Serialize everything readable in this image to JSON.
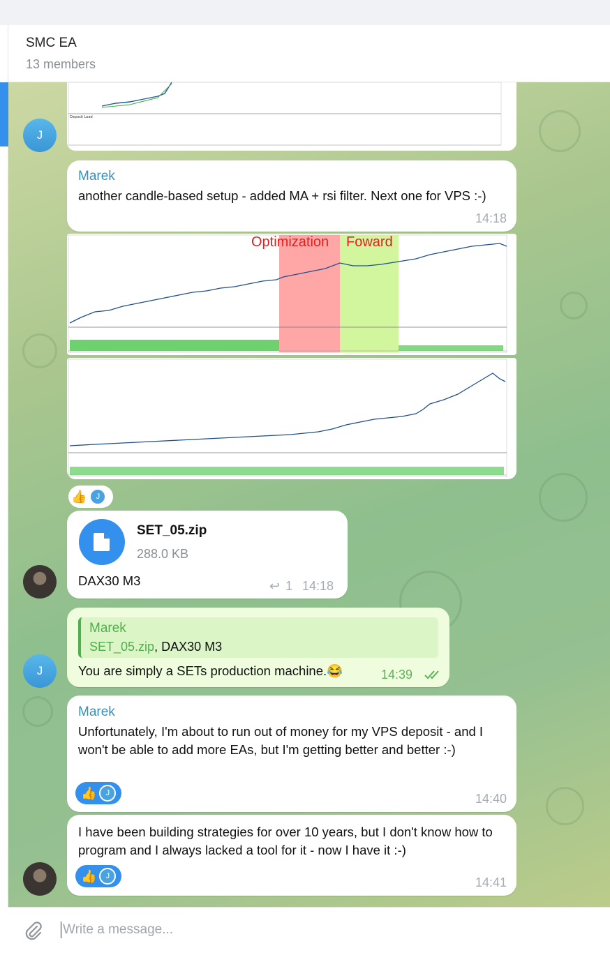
{
  "header": {
    "title": "SMC EA",
    "subtitle": "13 members"
  },
  "composer": {
    "placeholder": "Write a message..."
  },
  "messages": {
    "m1": {
      "sender": "Marek",
      "text": "another candle-based setup - added MA + rsi filter. Next one for VPS :-)",
      "time": "14:18"
    },
    "chart1": {
      "label_optimization": "Optimization",
      "label_forward": "Foward"
    },
    "file": {
      "name": "SET_05.zip",
      "size": "288.0 KB",
      "caption": "DAX30 M3",
      "replies": "1",
      "time": "14:18"
    },
    "reply": {
      "quote_sender": "Marek",
      "quote_file": "SET_05.zip",
      "quote_rest": ", DAX30 M3",
      "text": "You are simply a SETs production machine.",
      "emoji": "😂",
      "time": "14:39"
    },
    "m2": {
      "sender": "Marek",
      "text": "Unfortunately, I'm about to run out of money for my VPS deposit - and I won't be able to add more EAs, but I'm getting better and better :-)",
      "time": "14:40"
    },
    "m3": {
      "text": "I have been building strategies for over 10 years, but I don't know how to program and I always lacked a tool for it - now I have it :-)",
      "time": "14:41"
    }
  },
  "reactions": {
    "thumb": "👍",
    "initial": "J"
  },
  "avatars": {
    "j_initial": "J"
  },
  "icons": {
    "attach": "paperclip-icon",
    "file": "file-icon",
    "reply": "reply-icon",
    "read": "double-check-icon"
  },
  "colors": {
    "accent": "#3390ec",
    "sender": "#3a8fb7",
    "own_bubble": "#effdde",
    "optimization_band": "#ff8a8a",
    "forward_band": "#c9f58c"
  }
}
